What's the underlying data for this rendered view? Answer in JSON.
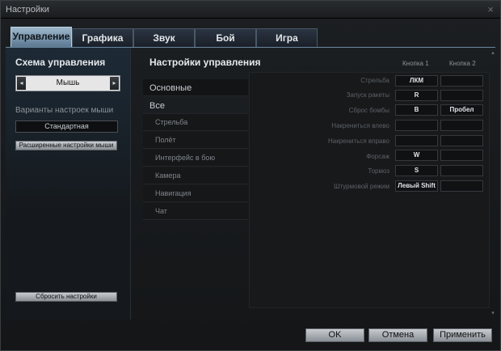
{
  "window": {
    "title": "Настройки",
    "close_glyph": "×"
  },
  "tabs": [
    "Управление",
    "Графика",
    "Звук",
    "Бой",
    "Игра"
  ],
  "left": {
    "scheme_title": "Схема управления",
    "scheme_value": "Мышь",
    "variants_label": "Варианты настроек мыши",
    "variant_value": "Стандартная",
    "advanced_button": "Расширенные настройки мыши",
    "reset_button": "Сбросить настройки"
  },
  "main": {
    "title": "Настройки управления",
    "col1": "Кнопка 1",
    "col2": "Кнопка 2",
    "categories": [
      "Основные",
      "Все"
    ],
    "subcategories": [
      "Стрельба",
      "Полёт",
      "Интерфейс в бою",
      "Камера",
      "Навигация",
      "Чат"
    ],
    "bindings": [
      {
        "action": "Стрельба",
        "k1": "ЛКМ",
        "k2": ""
      },
      {
        "action": "Запуск ракеты",
        "k1": "R",
        "k2": ""
      },
      {
        "action": "Сброс бомбы",
        "k1": "B",
        "k2": "Пробел"
      },
      {
        "action": "Накрениться влево",
        "k1": "",
        "k2": ""
      },
      {
        "action": "Накрениться вправо",
        "k1": "",
        "k2": ""
      },
      {
        "action": "Форсаж",
        "k1": "W",
        "k2": ""
      },
      {
        "action": "Тормоз",
        "k1": "S",
        "k2": ""
      },
      {
        "action": "Штурмовой режим",
        "k1": "Левый Shift",
        "k2": ""
      }
    ]
  },
  "footer": {
    "ok": "OK",
    "cancel": "Отмена",
    "apply": "Применить"
  },
  "icons": {
    "arrow_left": "◂",
    "arrow_right": "▸",
    "scroll_up": "▴",
    "scroll_down": "▾"
  }
}
